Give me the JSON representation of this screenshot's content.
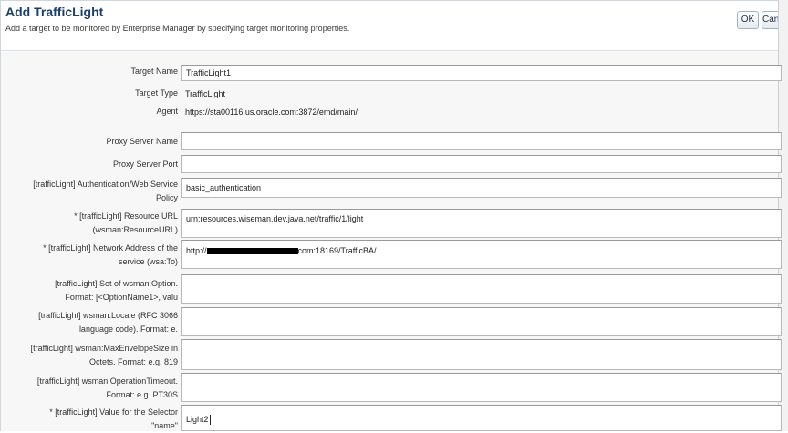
{
  "dialog": {
    "title": "Add TrafficLight",
    "description": "Add a target to be monitored by Enterprise Manager by specifying target monitoring properties.",
    "ok_label": "OK",
    "cancel_label": "Cancel"
  },
  "static_fields": {
    "target_name_label": "Target Name",
    "target_name_value": "TrafficLight1",
    "target_type_label": "Target Type",
    "target_type_value": "TrafficLight",
    "agent_label": "Agent",
    "agent_value": "https://sta00116.us.oracle.com:3872/emd/main/"
  },
  "properties": [
    {
      "label_line1": "Proxy Server Name",
      "label_line2": "",
      "value": ""
    },
    {
      "label_line1": "Proxy Server Port",
      "label_line2": "",
      "value": ""
    },
    {
      "label_line1": "[trafficLight] Authentication/Web Service",
      "label_line2": "Policy",
      "value": "basic_authentication"
    },
    {
      "label_line1": "* [trafficLight] Resource URL",
      "label_line2": "(wsman:ResourceURL)",
      "value": "urn:resources.wiseman.dev.java.net/traffic/1/light"
    },
    {
      "label_line1": "* [trafficLight] Network Address of the",
      "label_line2": "service (wsa:To)",
      "value_prefix": "http://",
      "value_suffix": "com:18169/TrafficBA/"
    },
    {
      "label_line1": "[trafficLight] Set of wsman:Option.",
      "label_line2": "Format: [<OptionName1>, valu",
      "value": ""
    },
    {
      "label_line1": "[trafficLight] wsman:Locale (RFC 3066",
      "label_line2": "language code). Format: e.",
      "value": ""
    },
    {
      "label_line1": "[trafficLight] wsman:MaxEnvelopeSize in",
      "label_line2": "Octets. Format: e.g. 819",
      "value": ""
    },
    {
      "label_line1": "[trafficLight] wsman:OperationTimeout.",
      "label_line2": "Format: e.g. PT30S",
      "value": ""
    },
    {
      "label_line1": "* [trafficLight] Value for the Selector",
      "label_line2": "\"name\"",
      "value": "Light2"
    }
  ]
}
